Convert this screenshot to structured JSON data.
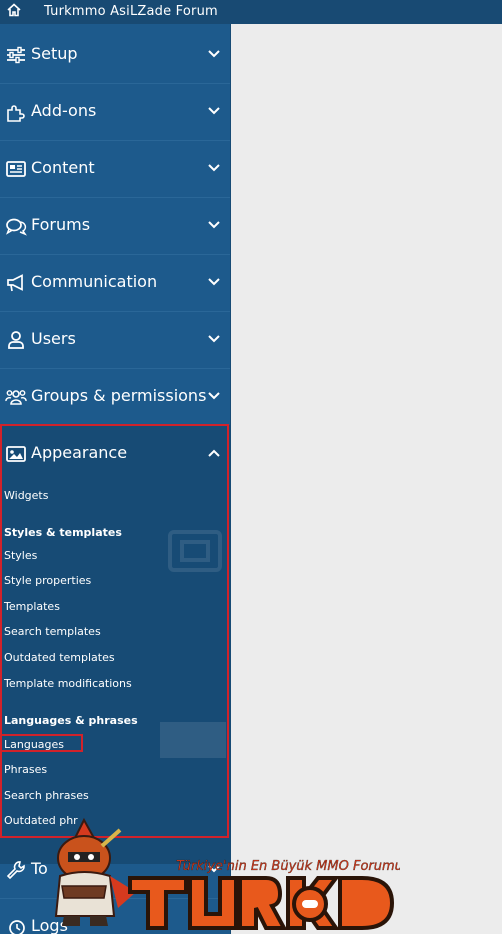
{
  "topbar": {
    "title": "Turkmmo AsiLZade Forum",
    "home_icon": "home-icon"
  },
  "nav": {
    "setup": "Setup",
    "addons": "Add-ons",
    "content": "Content",
    "forums": "Forums",
    "communication": "Communication",
    "users": "Users",
    "groups": "Groups & permissions",
    "appearance": "Appearance",
    "tools": "To",
    "logs": "Logs"
  },
  "appearance_menu": {
    "widgets": "Widgets",
    "styles_heading": "Styles & templates",
    "styles": "Styles",
    "style_properties": "Style properties",
    "templates": "Templates",
    "search_templates": "Search templates",
    "outdated_templates": "Outdated templates",
    "template_modifications": "Template modifications",
    "languages_heading": "Languages & phrases",
    "languages": "Languages",
    "phrases": "Phrases",
    "search_phrases": "Search phrases",
    "outdated_phrases": "Outdated phr"
  },
  "watermark": {
    "tagline": "Türkiye'nin En Büyük MMO Forumu",
    "logo_text": "TURKMMO"
  },
  "colors": {
    "sidebar": "#1d5a8c",
    "sidebar_active": "#174b75",
    "topbar": "#184a73",
    "content_bg": "#ececec",
    "highlight": "#d2222a",
    "logo_orange": "#e8591c"
  }
}
